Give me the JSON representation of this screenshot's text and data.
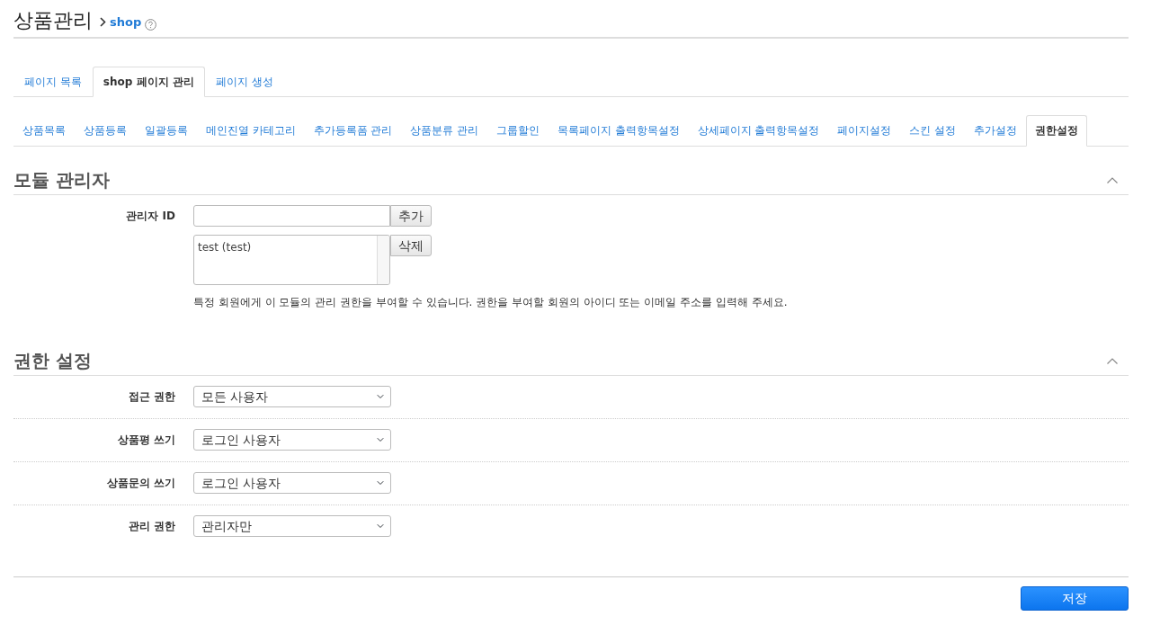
{
  "header": {
    "title": "상품관리",
    "breadcrumb": "shop"
  },
  "page_tabs": [
    {
      "label": "페이지 목록",
      "selected": false
    },
    {
      "label": "shop 페이지 관리",
      "selected": true
    },
    {
      "label": "페이지 생성",
      "selected": false
    }
  ],
  "sub_tabs": [
    {
      "label": "상품목록",
      "selected": false
    },
    {
      "label": "상품등록",
      "selected": false
    },
    {
      "label": "일괄등록",
      "selected": false
    },
    {
      "label": "메인진열 카테고리",
      "selected": false
    },
    {
      "label": "추가등록폼 관리",
      "selected": false
    },
    {
      "label": "상품분류 관리",
      "selected": false
    },
    {
      "label": "그룹할인",
      "selected": false
    },
    {
      "label": "목록페이지 출력항목설정",
      "selected": false
    },
    {
      "label": "상세페이지 출력항목설정",
      "selected": false
    },
    {
      "label": "페이지설정",
      "selected": false
    },
    {
      "label": "스킨 설정",
      "selected": false
    },
    {
      "label": "추가설정",
      "selected": false
    },
    {
      "label": "권한설정",
      "selected": true
    }
  ],
  "admin_section": {
    "title": "모듈 관리자",
    "expanded": true,
    "label": "관리자 ID",
    "add_button": "추가",
    "admin_list": [
      {
        "text": "test (test)",
        "selected": false
      }
    ],
    "delete_button": "삭제",
    "help": "특정 회원에게 이 모듈의 관리 권한을 부여할 수 있습니다. 권한을 부여할 회원의 아이디 또는 이메일 주소를 입력해 주세요."
  },
  "permission_section": {
    "title": "권한 설정",
    "expanded": true,
    "rows": [
      {
        "label": "접근 권한",
        "value": "모든 사용자"
      },
      {
        "label": "상품평 쓰기",
        "value": "로그인 사용자"
      },
      {
        "label": "상품문의 쓰기",
        "value": "로그인 사용자"
      },
      {
        "label": "관리 권한",
        "value": "관리자만"
      }
    ]
  },
  "save_button": "저장"
}
